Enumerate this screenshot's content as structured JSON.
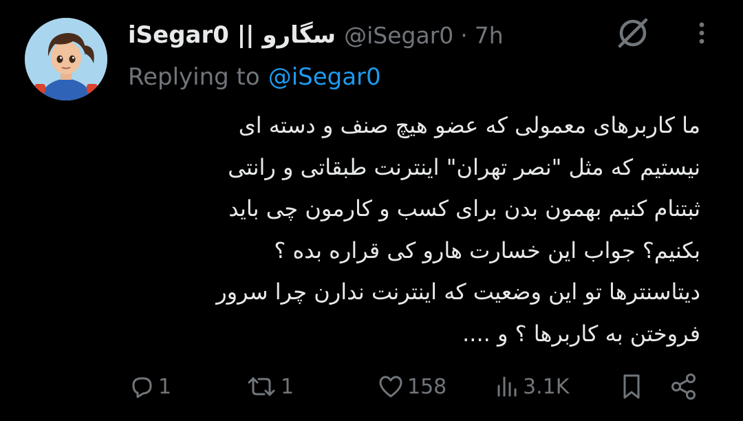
{
  "tweet": {
    "display_name": "iSegar0 || سگارو",
    "handle": "@iSegar0",
    "separator": "·",
    "time": "7h",
    "reply_prefix": "Replying to",
    "reply_mention": "@iSegar0",
    "body": "ما کاربرهای معمولی که عضو هیچ صنف و دسته ای\nنیستیم که مثل \"نصر تهران\" اینترنت طبقاتی و رانتی\nثبتنام کنیم بهمون بدن برای کسب و کارمون چی باید\nبکنیم؟ جواب این خسارت هارو کی قراره بده ؟\nدیتاسنترها تو این وضعیت که اینترنت ندارن چرا سرور\nفروختن به کاربرها ؟ و ....",
    "avatar_icon": "cartoon-avatar"
  },
  "actions": {
    "replies": "1",
    "reposts": "1",
    "likes": "158",
    "views": "3.1K"
  },
  "icons": {
    "grok": "grok-icon",
    "more": "more-icon",
    "reply": "reply-icon",
    "repost": "repost-icon",
    "like": "heart-icon",
    "views": "views-icon",
    "bookmark": "bookmark-icon",
    "share": "share-icon"
  },
  "colors": {
    "background": "#000000",
    "text_primary": "#e7e9ea",
    "text_secondary": "#71767b",
    "link": "#1d9bf0"
  }
}
